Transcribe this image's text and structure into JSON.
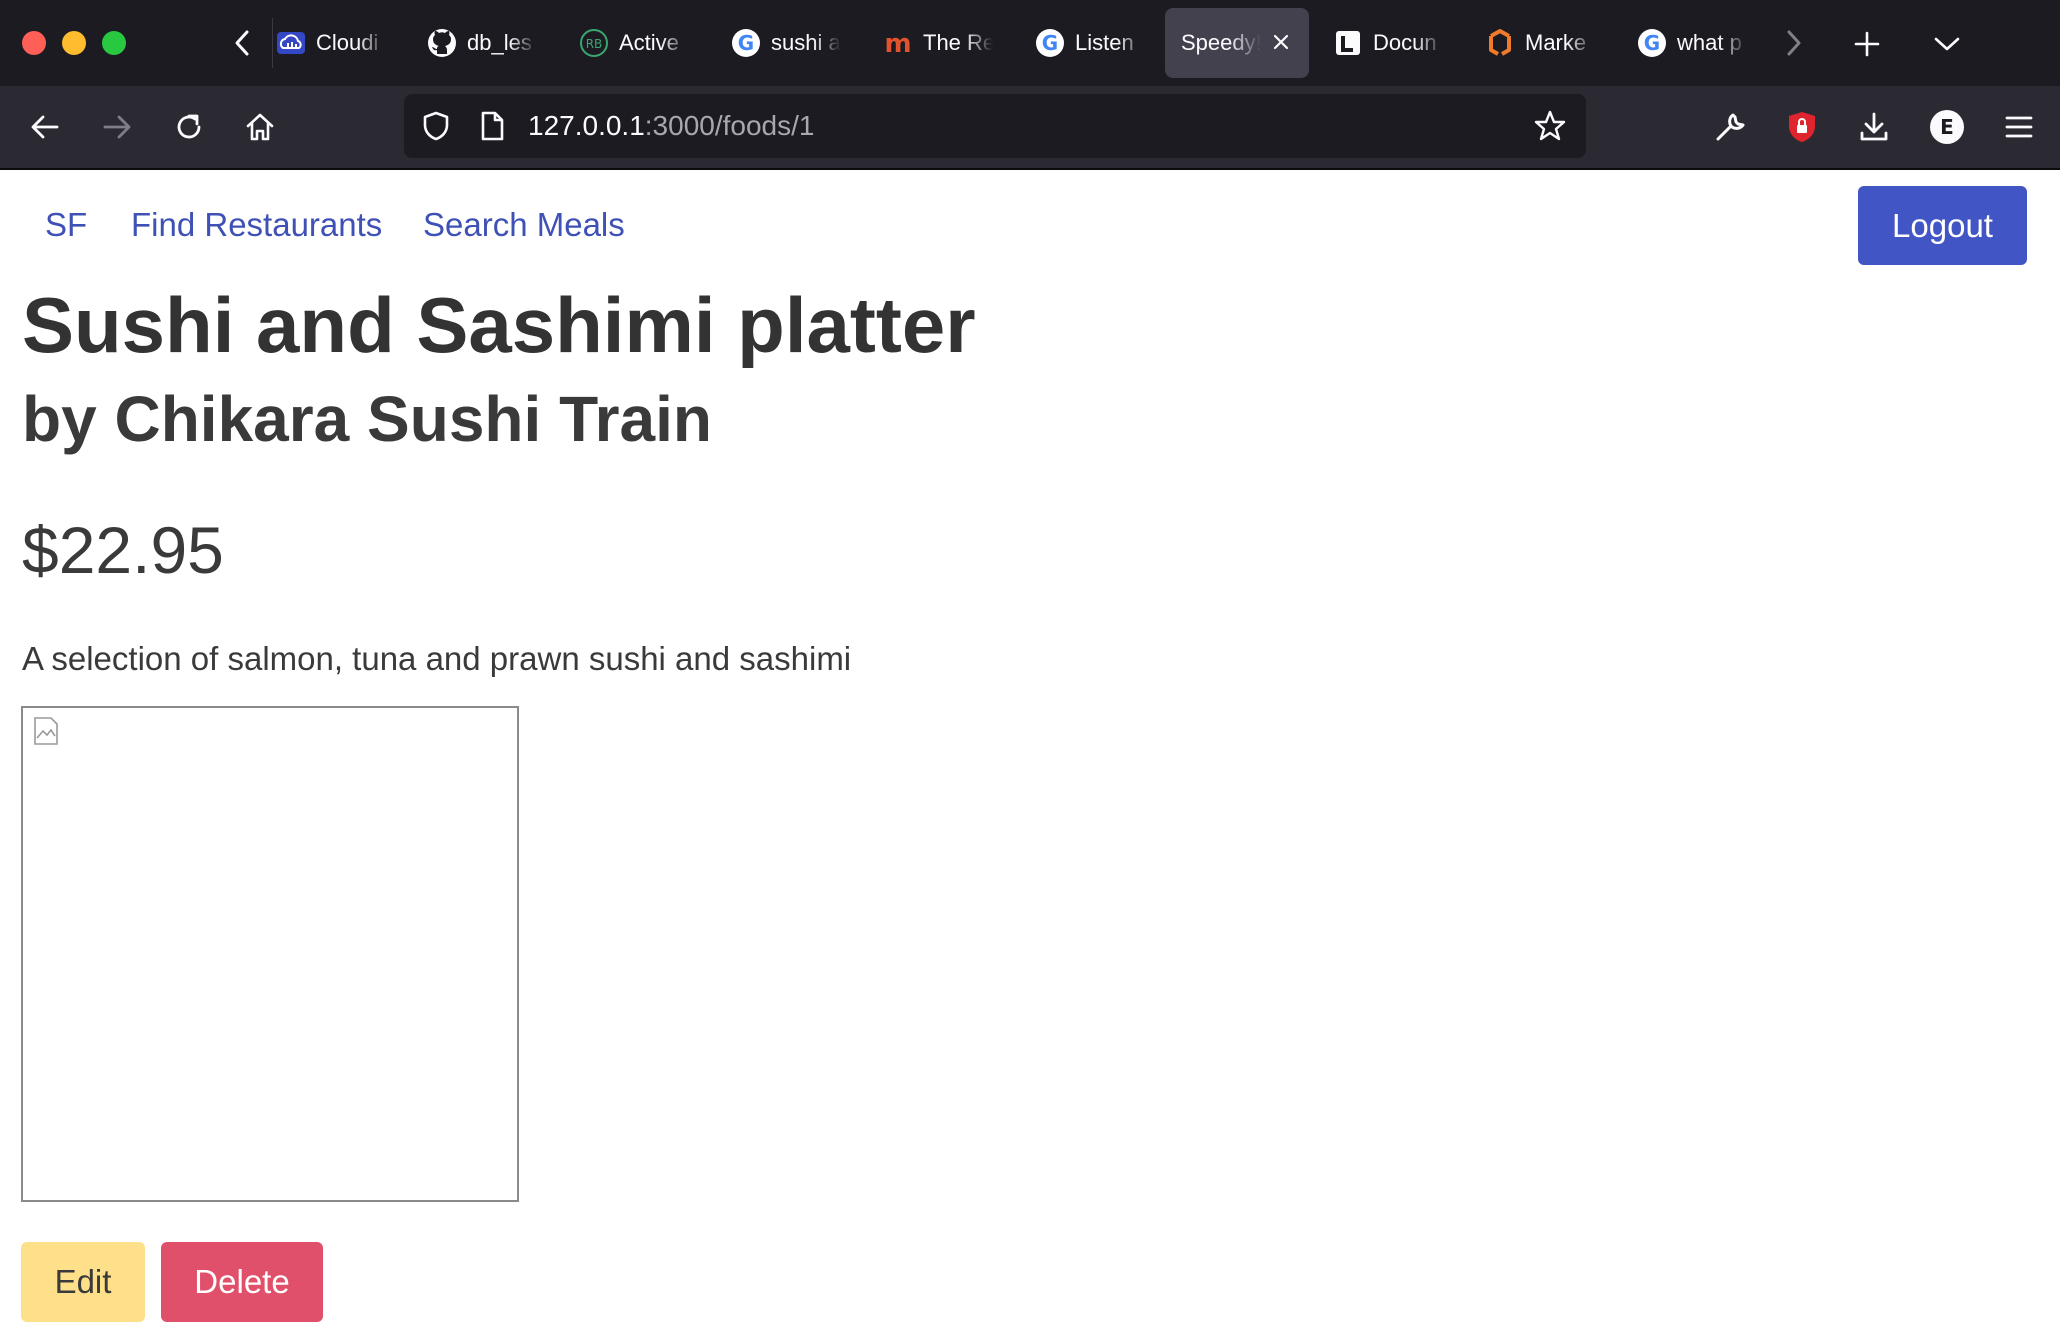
{
  "browser": {
    "tabs": [
      {
        "title": "Cloudi",
        "icon": "cloudinary-icon"
      },
      {
        "title": "db_les",
        "icon": "github-icon"
      },
      {
        "title": "Active",
        "icon": "rb-icon"
      },
      {
        "title": "sushi a",
        "icon": "google-icon"
      },
      {
        "title": "The Re",
        "icon": "m-icon"
      },
      {
        "title": "Listen",
        "icon": "google-icon"
      },
      {
        "title": "Speedy!",
        "icon": "none",
        "active": true
      },
      {
        "title": "Docun",
        "icon": "docs-icon"
      },
      {
        "title": "Marke",
        "icon": "marketplace-icon"
      },
      {
        "title": "what p",
        "icon": "google-icon"
      }
    ],
    "url": {
      "host": "127.0.0.1",
      "rest": ":3000/foods/1"
    },
    "profile_initial": "E"
  },
  "site_nav": {
    "brand": "SF",
    "links": [
      "Find Restaurants",
      "Search Meals"
    ],
    "logout_label": "Logout"
  },
  "food": {
    "name": "Sushi and Sashimi platter",
    "restaurant_line": "by Chikara Sushi Train",
    "price": "$22.95",
    "description": "A selection of salmon, tuna and prawn sushi and sashimi"
  },
  "actions": {
    "edit_label": "Edit",
    "delete_label": "Delete"
  },
  "colors": {
    "link": "#3f51b5",
    "logout_bg": "#4255c4",
    "edit_bg": "#ffe08a",
    "delete_bg": "#e0506a"
  }
}
